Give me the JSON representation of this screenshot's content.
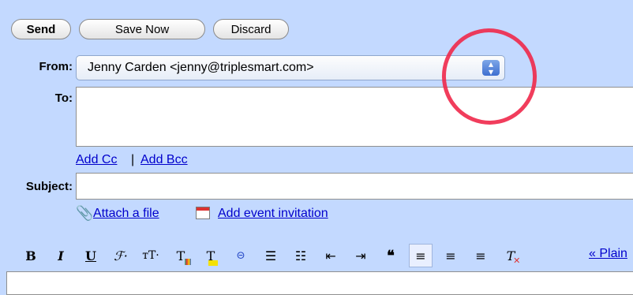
{
  "actions": {
    "send_label": "Send",
    "save_label": "Save Now",
    "discard_label": "Discard"
  },
  "from": {
    "label": "From:",
    "value": "Jenny Carden <jenny@triplesmart.com>"
  },
  "to": {
    "label": "To:",
    "value": ""
  },
  "cc_bcc": {
    "add_cc": "Add Cc",
    "separator": "|",
    "add_bcc": "Add Bcc"
  },
  "subject": {
    "label": "Subject:",
    "value": ""
  },
  "attachments": {
    "attach_file": "Attach a file",
    "add_event": "Add event invitation"
  },
  "toolbar": {
    "plain_text_link": "« Plain"
  },
  "colors": {
    "background": "#c3d9ff",
    "link": "#0000cc",
    "annotation_circle": "#f0284a"
  }
}
